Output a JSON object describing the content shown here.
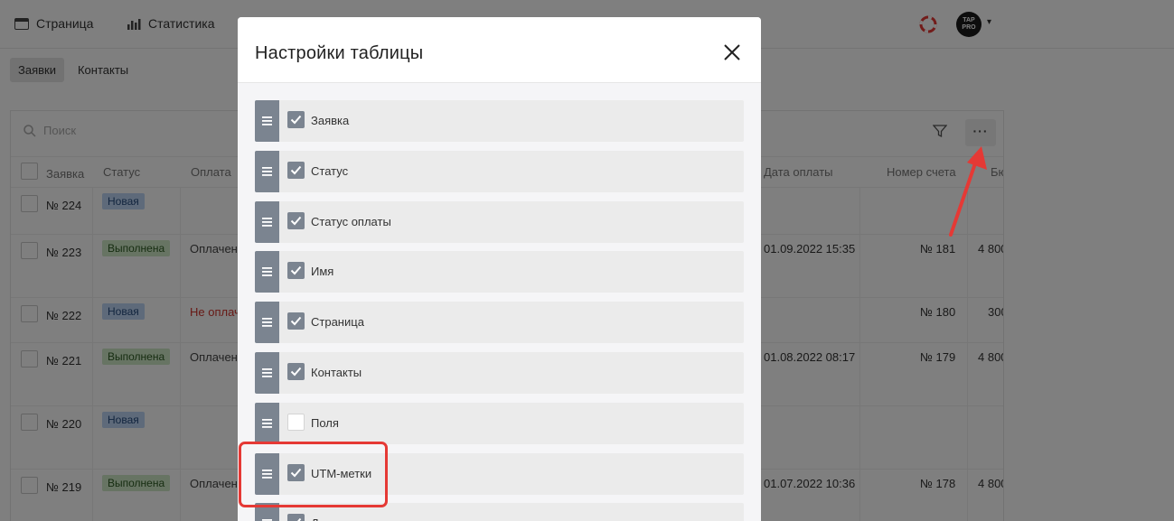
{
  "topbar": {
    "nav": [
      {
        "label": "Страница",
        "icon": "browser-window-icon"
      },
      {
        "label": "Статистика",
        "icon": "bar-chart-icon"
      }
    ],
    "help_icon": "lifebuoy-icon",
    "avatar_text": "TAP PRO"
  },
  "subtabs": [
    {
      "label": "Заявки",
      "active": true
    },
    {
      "label": "Контакты",
      "active": false
    }
  ],
  "search": {
    "placeholder": "Поиск"
  },
  "table": {
    "columns": [
      "Заявка",
      "Статус",
      "Оплата",
      "Дата оплаты",
      "Номер счета",
      "Бю"
    ],
    "rows": [
      {
        "id": "№ 224",
        "status": "Новая",
        "payment": "",
        "pay_date": "",
        "invoice": "",
        "amount": ""
      },
      {
        "id": "№ 223",
        "status": "Выполнена",
        "payment": "Оплачен",
        "pay_date": "01.09.2022 15:35",
        "invoice": "№ 181",
        "amount": "4 800"
      },
      {
        "id": "№ 222",
        "status": "Новая",
        "payment": "Не оплач",
        "pay_date": "",
        "invoice": "№ 180",
        "amount": "300"
      },
      {
        "id": "№ 221",
        "status": "Выполнена",
        "payment": "Оплачен",
        "pay_date": "01.08.2022 08:17",
        "invoice": "№ 179",
        "amount": "4 800"
      },
      {
        "id": "№ 220",
        "status": "Новая",
        "payment": "",
        "pay_date": "",
        "invoice": "",
        "amount": ""
      },
      {
        "id": "№ 219",
        "status": "Выполнена",
        "payment": "Оплачен",
        "pay_date": "01.07.2022 10:36",
        "invoice": "№ 178",
        "amount": "4 800"
      }
    ]
  },
  "modal": {
    "title": "Настройки таблицы",
    "items": [
      {
        "label": "Заявка",
        "checked": true
      },
      {
        "label": "Статус",
        "checked": true
      },
      {
        "label": "Статус оплаты",
        "checked": true
      },
      {
        "label": "Имя",
        "checked": true
      },
      {
        "label": "Страница",
        "checked": true
      },
      {
        "label": "Контакты",
        "checked": true
      },
      {
        "label": "Поля",
        "checked": false
      },
      {
        "label": "UTM-метки",
        "checked": true
      },
      {
        "label": "Д",
        "checked": true
      }
    ]
  },
  "colors": {
    "handle": "#7b8490",
    "highlight": "#e53935",
    "badge_new": "#bcd4f5",
    "badge_done": "#cfe8c6",
    "unpaid": "#d0342c"
  }
}
